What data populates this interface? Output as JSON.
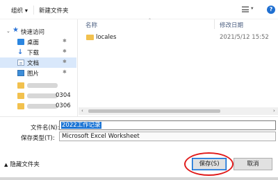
{
  "toolbar": {
    "organize_label": "组织 ▾",
    "new_folder_label": "新建文件夹",
    "view_icon": "view-list-icon",
    "help_icon": "help-icon",
    "help_glyph": "?"
  },
  "nav": {
    "quick_access_label": "快速访问",
    "items": [
      {
        "label": "桌面",
        "icon": "desktop-icon",
        "pinned": true
      },
      {
        "label": "下载",
        "icon": "download-icon",
        "pinned": true
      },
      {
        "label": "文档",
        "icon": "documents-icon",
        "pinned": true,
        "selected": true
      },
      {
        "label": "图片",
        "icon": "pictures-icon",
        "pinned": true
      }
    ],
    "redacted_items": [
      {
        "suffix": ""
      },
      {
        "suffix": "0304"
      },
      {
        "suffix": "0306"
      }
    ],
    "pin_glyph": "✱"
  },
  "file_list": {
    "columns": {
      "name": "名称",
      "date_modified": "修改日期"
    },
    "rows": [
      {
        "name": "locales",
        "date_modified": "2021/5/12 15:52",
        "icon": "folder-icon"
      }
    ]
  },
  "form": {
    "filename_label": "文件名(N):",
    "filename_value": "2022工作记录",
    "filetype_label": "保存类型(T):",
    "filetype_value": "Microsoft Excel Worksheet"
  },
  "footer": {
    "hide_folders_label": "隐藏文件夹",
    "save_label": "保存(S)",
    "cancel_label": "取消"
  },
  "colors": {
    "accent": "#1b74d4",
    "annotation_ring": "#e01b1b"
  }
}
